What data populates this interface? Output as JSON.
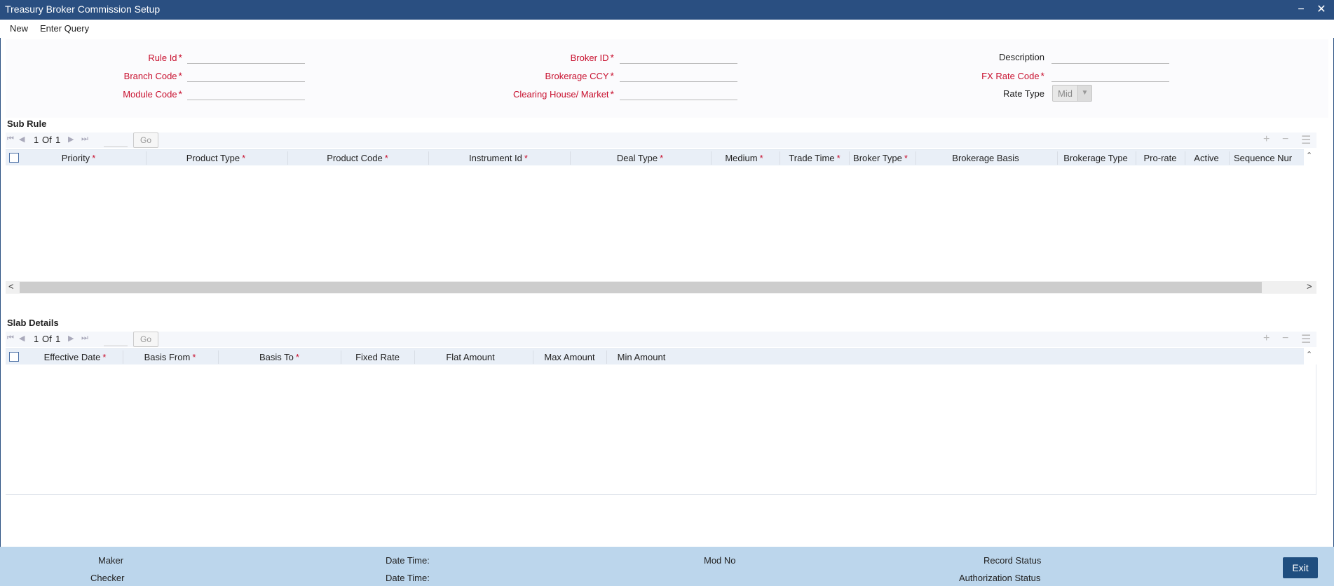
{
  "window": {
    "title": "Treasury Broker Commission Setup",
    "minimize_glyph": "−",
    "close_glyph": "✕"
  },
  "toolbar": {
    "new_label": "New",
    "enter_query_label": "Enter Query"
  },
  "form": {
    "rule_id_label": "Rule Id",
    "branch_code_label": "Branch Code",
    "module_code_label": "Module Code",
    "broker_id_label": "Broker ID",
    "brokerage_ccy_label": "Brokerage CCY",
    "clearing_house_label": "Clearing House/ Market",
    "description_label": "Description",
    "fx_rate_code_label": "FX Rate Code",
    "rate_type_label": "Rate Type",
    "rate_type_value": "Mid",
    "required_mark": "*"
  },
  "sub_rule": {
    "title": "Sub Rule",
    "pager": {
      "current": "1",
      "of_label": "Of",
      "total": "1",
      "go_label": "Go"
    },
    "columns": [
      {
        "label": "Priority",
        "required": "*"
      },
      {
        "label": "Product Type",
        "required": "*"
      },
      {
        "label": "Product Code",
        "required": "*"
      },
      {
        "label": "Instrument Id",
        "required": "*"
      },
      {
        "label": "Deal Type",
        "required": "*"
      },
      {
        "label": "Medium",
        "required": "*"
      },
      {
        "label": "Trade Time",
        "required": "*"
      },
      {
        "label": "Broker Type",
        "required": "*"
      },
      {
        "label": "Brokerage Basis",
        "required": ""
      },
      {
        "label": "Brokerage Type",
        "required": ""
      },
      {
        "label": "Pro-rate",
        "required": ""
      },
      {
        "label": "Active",
        "required": ""
      },
      {
        "label": "Sequence Nur",
        "required": ""
      }
    ]
  },
  "slab_details": {
    "title": "Slab Details",
    "pager": {
      "current": "1",
      "of_label": "Of",
      "total": "1",
      "go_label": "Go"
    },
    "columns": [
      {
        "label": "Effective Date",
        "required": "*"
      },
      {
        "label": "Basis From",
        "required": "*"
      },
      {
        "label": "Basis To",
        "required": "*"
      },
      {
        "label": "Fixed Rate",
        "required": ""
      },
      {
        "label": "Flat Amount",
        "required": ""
      },
      {
        "label": "Max Amount",
        "required": ""
      },
      {
        "label": "Min Amount",
        "required": ""
      }
    ]
  },
  "footer": {
    "maker_label": "Maker",
    "checker_label": "Checker",
    "date_time_label_1": "Date Time:",
    "date_time_label_2": "Date Time:",
    "mod_no_label": "Mod No",
    "record_status_label": "Record Status",
    "authorization_status_label": "Authorization Status",
    "exit_label": "Exit"
  },
  "colors": {
    "titlebar": "#2a4f81",
    "required": "#c8102e",
    "grid_header": "#e9eff7",
    "footer": "#bcd6ec",
    "exit_button": "#1f4e7f"
  }
}
